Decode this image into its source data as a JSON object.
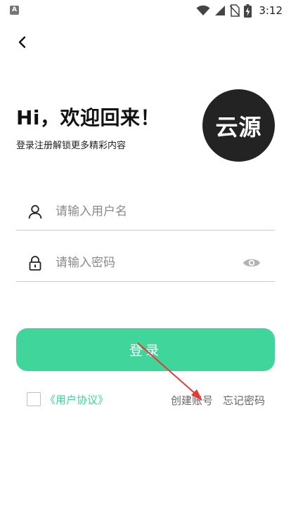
{
  "statusbar": {
    "app_badge": "A",
    "time": "3:12",
    "icons": [
      "wifi-icon",
      "signal-icon",
      "no-sim-icon",
      "battery-charging-icon"
    ]
  },
  "nav": {
    "back_icon": "chevron-left-icon"
  },
  "header": {
    "greeting": "Hi，欢迎回来！",
    "subtitle": "登录注册解锁更多精彩内容",
    "logo_text": "云源"
  },
  "form": {
    "username": {
      "value": "",
      "placeholder": "请输入用户名",
      "icon": "user-icon"
    },
    "password": {
      "value": "",
      "placeholder": "请输入密码",
      "icon": "lock-icon",
      "toggle_icon": "eye-icon"
    },
    "login_label": "登录"
  },
  "footer": {
    "agreement_checked": false,
    "agreement_label": "《用户协议》",
    "create_account": "创建账号",
    "forgot_password": "忘记密码"
  },
  "colors": {
    "accent": "#3fd59b",
    "logo_bg": "#232323",
    "annotation_arrow": "#e53935"
  }
}
